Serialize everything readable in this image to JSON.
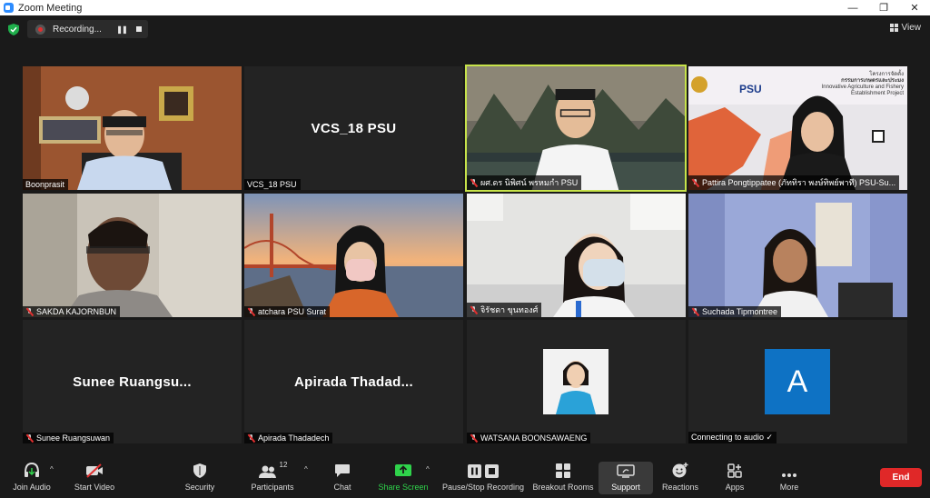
{
  "window": {
    "title": "Zoom Meeting",
    "minimize": "—",
    "maximize": "❐",
    "close": "✕"
  },
  "recording": {
    "label": "Recording...",
    "pause": "❚❚"
  },
  "view": {
    "label": "View"
  },
  "tiles": [
    {
      "name": "Boonprasit",
      "muted": false,
      "active": false
    },
    {
      "name": "VCS_18 PSU",
      "display": "VCS_18 PSU",
      "muted": false,
      "active": false
    },
    {
      "name": "ผศ.ดร นิพิศน์ พรหมกำ PSU",
      "muted": true,
      "active": true
    },
    {
      "name": "Pattira Pongtippatee (ภัททิรา พงษ์ทิพย์พาที) PSU-Su...",
      "muted": true,
      "active": false,
      "banner": {
        "brand": "PSU",
        "thai": "โครงการจัดตั้ง",
        "thai2": "กรรมการเกษตรและประมง",
        "eng": "Innovative Agriculture and Fishery",
        "eng2": "Establishment Project"
      }
    },
    {
      "name": "SAKDA KAJORNBUN",
      "muted": true,
      "active": false
    },
    {
      "name": "atchara  PSU Surat",
      "muted": true,
      "active": false
    },
    {
      "name": "จิรัชดา ขุนทองศ์",
      "muted": true,
      "active": false
    },
    {
      "name": "Suchada Tipmontree",
      "muted": true,
      "active": false
    },
    {
      "name": "Sunee Ruangsuwan",
      "display": "Sunee  Ruangsu...",
      "muted": true,
      "active": false
    },
    {
      "name": "Apirada Thadadech",
      "display": "Apirada  Thadad...",
      "muted": true,
      "active": false
    },
    {
      "name": "WATSANA BOONSAWAENG",
      "muted": true,
      "active": false
    },
    {
      "name": "Connecting to audio ✓",
      "avatar_letter": "A",
      "muted": false,
      "active": false
    }
  ],
  "toolbar": {
    "join_audio": "Join Audio",
    "start_video": "Start Video",
    "security": "Security",
    "participants": "Participants",
    "participants_count": "12",
    "chat": "Chat",
    "share_screen": "Share Screen",
    "pause_stop_recording": "Pause/Stop Recording",
    "breakout_rooms": "Breakout Rooms",
    "support": "Support",
    "reactions": "Reactions",
    "apps": "Apps",
    "more": "More",
    "end": "End",
    "caret": "^"
  },
  "colors": {
    "active_speaker": "#c7e34a",
    "end": "#e02828",
    "share": "#2fd34b",
    "avatar": "#0e72c4"
  }
}
